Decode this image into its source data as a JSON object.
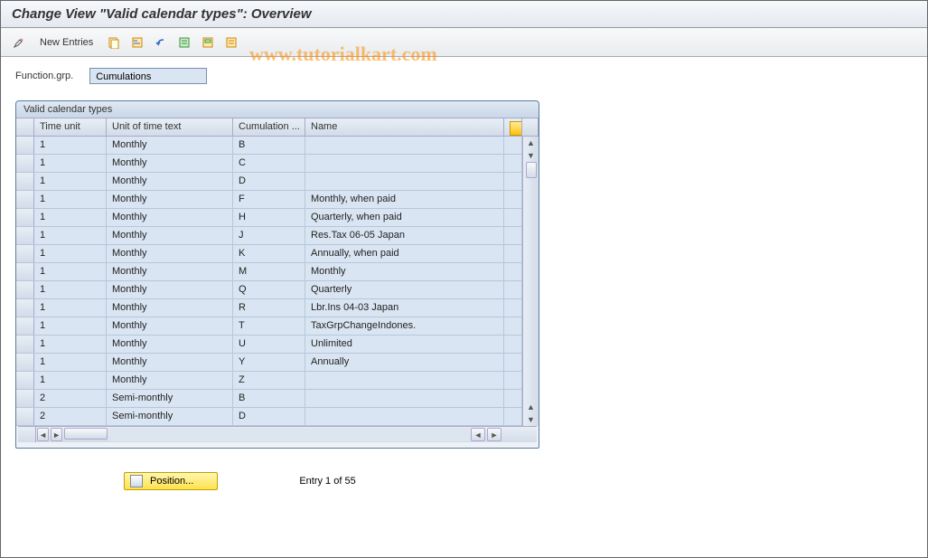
{
  "title": "Change View \"Valid calendar types\": Overview",
  "watermark": "www.tutorialkart.com",
  "toolbar": {
    "change_tip": "Change",
    "new_entries": "New Entries",
    "copy_tip": "Copy As...",
    "delete_tip": "Delete",
    "undo_tip": "Undo Change",
    "select_all_tip": "Select All",
    "select_block_tip": "Select Block",
    "deselect_all_tip": "Deselect All"
  },
  "field": {
    "label": "Function.grp.",
    "value": "Cumulations"
  },
  "panel": {
    "title": "Valid calendar types",
    "columns": {
      "c1": "Time unit",
      "c2": "Unit of time text",
      "c3": "Cumulation ...",
      "c4": "Name"
    },
    "rows": [
      {
        "c1": "1",
        "c2": "Monthly",
        "c3": "B",
        "c4": ""
      },
      {
        "c1": "1",
        "c2": "Monthly",
        "c3": "C",
        "c4": ""
      },
      {
        "c1": "1",
        "c2": "Monthly",
        "c3": "D",
        "c4": ""
      },
      {
        "c1": "1",
        "c2": "Monthly",
        "c3": "F",
        "c4": "Monthly, when paid"
      },
      {
        "c1": "1",
        "c2": "Monthly",
        "c3": "H",
        "c4": "Quarterly, when paid"
      },
      {
        "c1": "1",
        "c2": "Monthly",
        "c3": "J",
        "c4": "Res.Tax 06-05  Japan"
      },
      {
        "c1": "1",
        "c2": "Monthly",
        "c3": "K",
        "c4": "Annually, when paid"
      },
      {
        "c1": "1",
        "c2": "Monthly",
        "c3": "M",
        "c4": "Monthly"
      },
      {
        "c1": "1",
        "c2": "Monthly",
        "c3": "Q",
        "c4": "Quarterly"
      },
      {
        "c1": "1",
        "c2": "Monthly",
        "c3": "R",
        "c4": "Lbr.Ins 04-03  Japan"
      },
      {
        "c1": "1",
        "c2": "Monthly",
        "c3": "T",
        "c4": "TaxGrpChangeIndones."
      },
      {
        "c1": "1",
        "c2": "Monthly",
        "c3": "U",
        "c4": "Unlimited"
      },
      {
        "c1": "1",
        "c2": "Monthly",
        "c3": "Y",
        "c4": "Annually"
      },
      {
        "c1": "1",
        "c2": "Monthly",
        "c3": "Z",
        "c4": ""
      },
      {
        "c1": "2",
        "c2": "Semi-monthly",
        "c3": "B",
        "c4": ""
      },
      {
        "c1": "2",
        "c2": "Semi-monthly",
        "c3": "D",
        "c4": ""
      }
    ]
  },
  "footer": {
    "position_label": "Position...",
    "entry_text": "Entry 1 of 55"
  }
}
